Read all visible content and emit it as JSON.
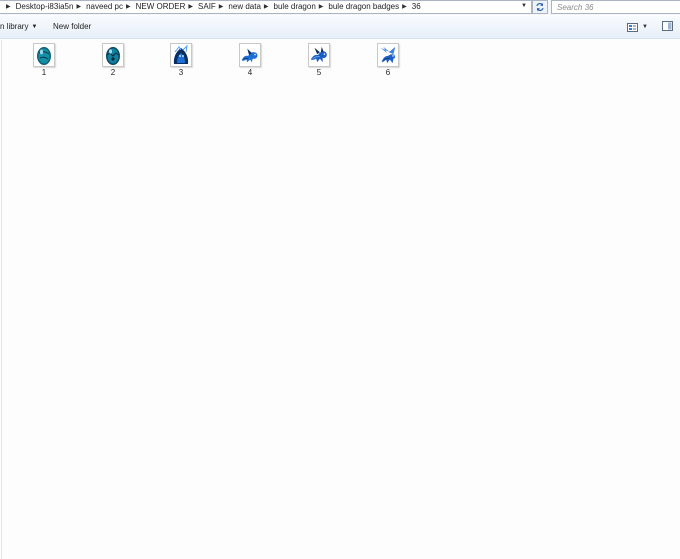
{
  "address_bar": {
    "crumbs": [
      "Desktop-i83ia5n",
      "naveed pc",
      "NEW ORDER",
      "SAIF",
      "new data",
      "bule dragon",
      "bule dragon badges",
      "36"
    ]
  },
  "search": {
    "placeholder": "Search 36"
  },
  "toolbar": {
    "include_label": "n library",
    "new_folder_label": "New folder"
  },
  "files": [
    {
      "name": "1",
      "icon": "egg-icon"
    },
    {
      "name": "2",
      "icon": "egg-icon"
    },
    {
      "name": "3",
      "icon": "hatching-dragon-icon"
    },
    {
      "name": "4",
      "icon": "dragon-icon"
    },
    {
      "name": "5",
      "icon": "dragon-icon"
    },
    {
      "name": "6",
      "icon": "winged-dragon-icon"
    }
  ],
  "colors": {
    "thumb_primary": "#1d6fd8",
    "thumb_dark": "#0a2f5e",
    "thumb_teal": "#1bb6c9",
    "window_bg": "#fdfdfd"
  }
}
